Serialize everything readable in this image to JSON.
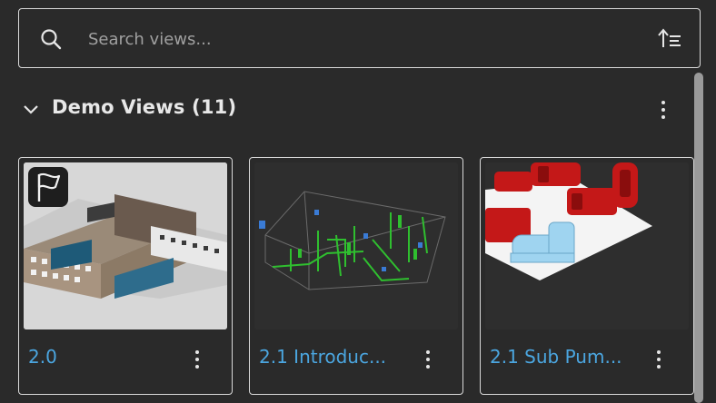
{
  "search": {
    "placeholder": "Search views..."
  },
  "group": {
    "title": "Demo Views (11)"
  },
  "cards": [
    {
      "label": "2.0",
      "badge": "flag-icon"
    },
    {
      "label": "2.1 Introduc..."
    },
    {
      "label": "2.1 Sub Pum..."
    }
  ],
  "colors": {
    "accent": "#4ba6e0",
    "background": "#2a2a2a",
    "border": "#d9d9d9"
  }
}
